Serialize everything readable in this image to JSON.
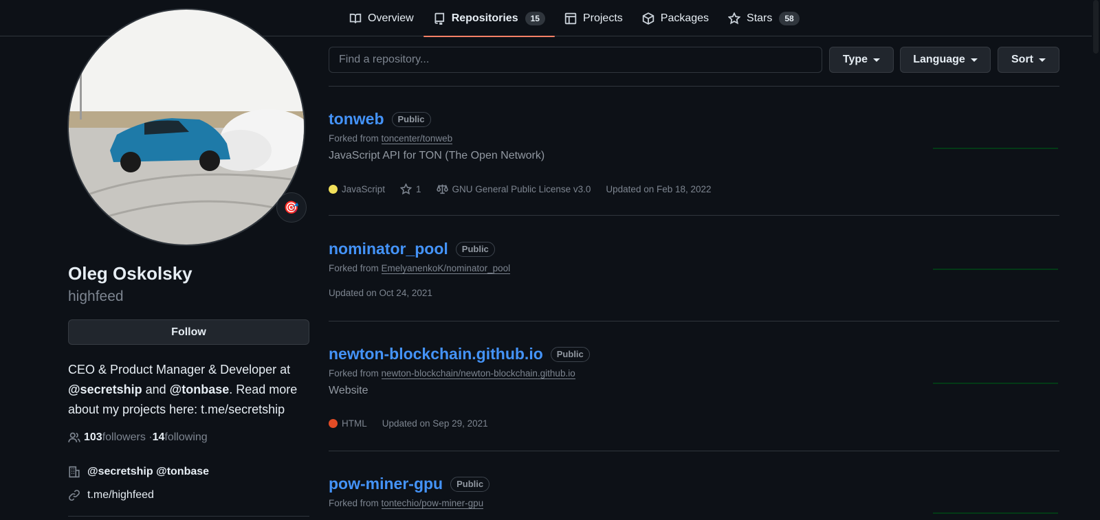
{
  "nav": {
    "tabs": [
      {
        "label": "Overview",
        "icon": "book-icon"
      },
      {
        "label": "Repositories",
        "icon": "repo-icon",
        "count": "15"
      },
      {
        "label": "Projects",
        "icon": "table-icon"
      },
      {
        "label": "Packages",
        "icon": "package-icon"
      },
      {
        "label": "Stars",
        "icon": "star-icon",
        "count": "58"
      }
    ],
    "active_tab": "Repositories",
    "accent_color": "#f78166"
  },
  "profile": {
    "name": "Oleg Oskolsky",
    "login": "highfeed",
    "follow_label": "Follow",
    "status_emoji": "🎯",
    "bio_parts": {
      "p1": "CEO & Product Manager & Developer at ",
      "org1": "@secretship",
      "p2": " and ",
      "org2": "@tonbase",
      "p3": ". Read more about my projects here: t.me/secretship"
    },
    "followers_count": "103",
    "followers_label": " followers · ",
    "following_count": "14",
    "following_label": " following",
    "organization": "@secretship @tonbase",
    "website": "t.me/highfeed"
  },
  "filters": {
    "search_placeholder": "Find a repository...",
    "type_label": "Type",
    "language_label": "Language",
    "sort_label": "Sort"
  },
  "repos": [
    {
      "name": "tonweb",
      "visibility": "Public",
      "forked_prefix": "Forked from ",
      "forked_from": "toncenter/tonweb",
      "description": "JavaScript API for TON (The Open Network)",
      "language": "JavaScript",
      "language_color": "#f1e05a",
      "stars": "1",
      "license": "GNU General Public License v3.0",
      "updated": "Updated on Feb 18, 2022"
    },
    {
      "name": "nominator_pool",
      "visibility": "Public",
      "forked_prefix": "Forked from ",
      "forked_from": "EmelyanenkoK/nominator_pool",
      "updated": "Updated on Oct 24, 2021"
    },
    {
      "name": "newton-blockchain.github.io",
      "visibility": "Public",
      "forked_prefix": "Forked from ",
      "forked_from": "newton-blockchain/newton-blockchain.github.io",
      "description": "Website",
      "language": "HTML",
      "language_color": "#e34c26",
      "updated": "Updated on Sep 29, 2021"
    },
    {
      "name": "pow-miner-gpu",
      "visibility": "Public",
      "forked_prefix": "Forked from ",
      "forked_from": "tontechio/pow-miner-gpu"
    }
  ]
}
